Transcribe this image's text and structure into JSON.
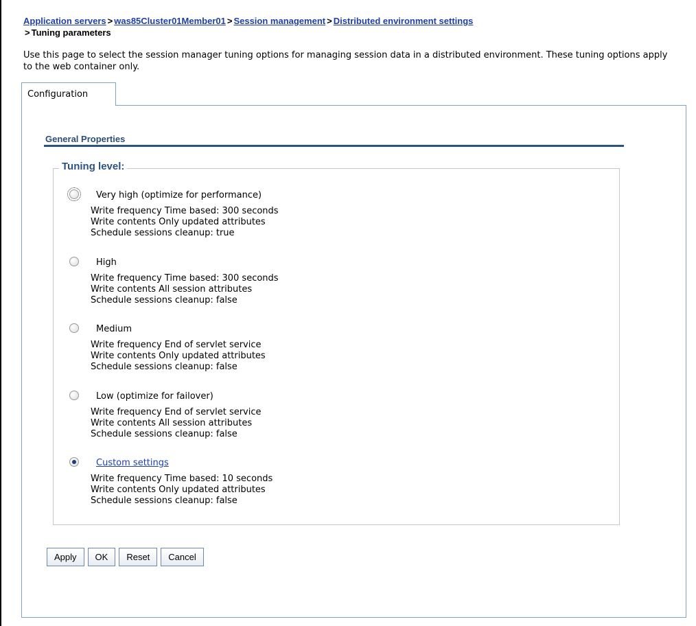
{
  "breadcrumb": {
    "items": [
      "Application servers",
      "was85Cluster01Member01",
      "Session management",
      "Distributed environment settings"
    ],
    "separator": ">",
    "current": "Tuning parameters"
  },
  "description": "Use this page to select the session manager tuning options for managing session data in a distributed environment. These tuning options apply to the web container only.",
  "tabs": [
    {
      "label": "Configuration"
    }
  ],
  "general_properties": {
    "title": "General Properties"
  },
  "tuning": {
    "legend": "Tuning level:",
    "selected": "Custom settings",
    "options": [
      {
        "label": "Very high (optimize for performance)",
        "details": [
          "Write frequency Time based: 300 seconds",
          "Write contents Only updated attributes",
          "Schedule sessions cleanup: true"
        ]
      },
      {
        "label": "High",
        "details": [
          "Write frequency Time based: 300 seconds",
          "Write contents All session attributes",
          "Schedule sessions cleanup: false"
        ]
      },
      {
        "label": "Medium",
        "details": [
          "Write frequency End of servlet service",
          "Write contents Only updated attributes",
          "Schedule sessions cleanup: false"
        ]
      },
      {
        "label": "Low (optimize for failover)",
        "details": [
          "Write frequency End of servlet service",
          "Write contents All session attributes",
          "Schedule sessions cleanup: false"
        ]
      },
      {
        "label": "Custom settings",
        "details": [
          "Write frequency Time based: 10 seconds",
          "Write contents Only updated attributes",
          "Schedule sessions cleanup: false"
        ]
      }
    ]
  },
  "buttons": {
    "apply": "Apply",
    "ok": "OK",
    "reset": "Reset",
    "cancel": "Cancel"
  },
  "colors": {
    "link": "#1f3fa8",
    "section_title": "#2a4d7a",
    "section_rule": "#2a5283",
    "panel_border": "#7ea3c7"
  }
}
